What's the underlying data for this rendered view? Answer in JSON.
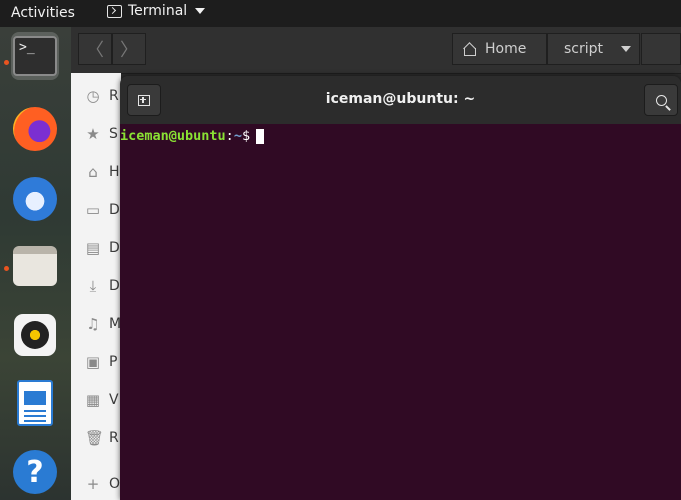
{
  "topbar": {
    "activities": "Activities",
    "app_name": "Terminal"
  },
  "dock": {
    "items": [
      {
        "name": "Terminal",
        "icon": "terminal-icon",
        "active": true,
        "running": true
      },
      {
        "name": "Firefox",
        "icon": "firefox-icon",
        "running": false
      },
      {
        "name": "Thunderbird",
        "icon": "thunderbird-icon",
        "running": false
      },
      {
        "name": "Files",
        "icon": "files-icon",
        "running": true
      },
      {
        "name": "Rhythmbox",
        "icon": "rhythmbox-icon",
        "running": false
      },
      {
        "name": "LibreOffice Writer",
        "icon": "writer-icon",
        "running": false
      },
      {
        "name": "Help",
        "icon": "help-icon",
        "glyph": "?",
        "running": false
      }
    ],
    "terminal_glyph": ">_"
  },
  "files": {
    "path": {
      "home_label": "Home",
      "current_label": "script"
    },
    "nav": {
      "back": "〈",
      "forward": "〉"
    },
    "sidebar": {
      "items": [
        {
          "label": "R",
          "icon": "◷"
        },
        {
          "label": "S",
          "icon": "★"
        },
        {
          "label": "H",
          "icon": "⌂"
        },
        {
          "label": "D",
          "icon": "▭"
        },
        {
          "label": "D",
          "icon": "▤"
        },
        {
          "label": "D",
          "icon": "⤓"
        },
        {
          "label": "M",
          "icon": "♫"
        },
        {
          "label": "P",
          "icon": "▣"
        },
        {
          "label": "V",
          "icon": "▦"
        },
        {
          "label": "R",
          "icon": "🗑"
        },
        {
          "label": "O",
          "icon": "+"
        }
      ]
    }
  },
  "terminal": {
    "title": "iceman@ubuntu: ~",
    "prompt": {
      "user_host": "iceman@ubuntu",
      "colon": ":",
      "path": "~",
      "dollar": "$"
    }
  },
  "colors": {
    "terminal_bg": "#300a24",
    "prompt_user": "#8ae234",
    "prompt_path": "#729fcf",
    "accent": "#e95420"
  }
}
